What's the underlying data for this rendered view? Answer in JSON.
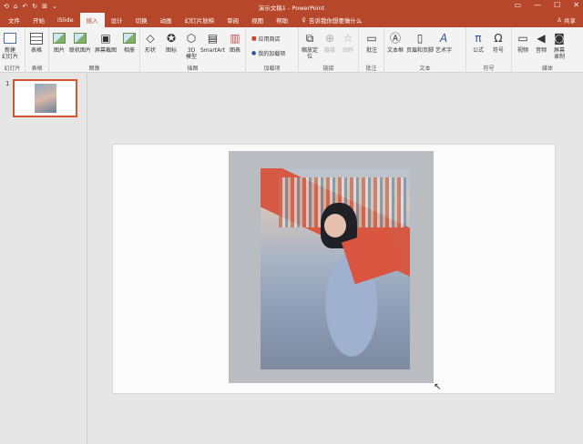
{
  "titlebar": {
    "app_title": "演示文稿1  -  PowerPoint",
    "qat": [
      "⟲",
      "⌂",
      "↶",
      "↻",
      "⊞",
      "⌄"
    ],
    "controls": [
      "▭",
      "—",
      "☐",
      "✕"
    ]
  },
  "menubar": {
    "tabs": [
      "文件",
      "开始",
      "iSlide",
      "插入",
      "设计",
      "切换",
      "动画",
      "幻灯片放映",
      "审阅",
      "视图",
      "帮助"
    ],
    "active_tab": "插入",
    "tellme": "告诉我你想要做什么",
    "share": "共享"
  },
  "ribbon": {
    "groups": {
      "slides": {
        "label": "幻灯片",
        "new_slide": "新建\n幻灯片"
      },
      "tables": {
        "label": "表格",
        "table": "表格"
      },
      "images": {
        "label": "图像",
        "picture": "图片",
        "online_picture": "联机图片",
        "screenshot": "屏幕截图",
        "album": "相册"
      },
      "illustrations": {
        "label": "插图",
        "shapes": "形状",
        "icons": "图标",
        "model3d": "3D\n模型",
        "smartart": "SmartArt",
        "chart": "图表"
      },
      "addins": {
        "label": "加载项",
        "store": "应用商店",
        "my_addins": "我的加载项"
      },
      "links": {
        "label": "链接",
        "zoom": "缩放定\n位",
        "link": "链接",
        "action": "动作"
      },
      "comments": {
        "label": "批注",
        "comment": "批注"
      },
      "text": {
        "label": "文本",
        "textbox": "文本框",
        "header_footer": "页眉和页脚",
        "wordart": "艺术字"
      },
      "symbols": {
        "label": "符号",
        "equation": "公式",
        "symbol": "符号"
      },
      "media": {
        "label": "媒体",
        "video": "视频",
        "audio": "音频",
        "screen_record": "屏幕\n录制"
      }
    }
  },
  "leftpane": {
    "slide_number": "1"
  },
  "colors": {
    "accent": "#b7472a",
    "thumb_border": "#d35230"
  }
}
